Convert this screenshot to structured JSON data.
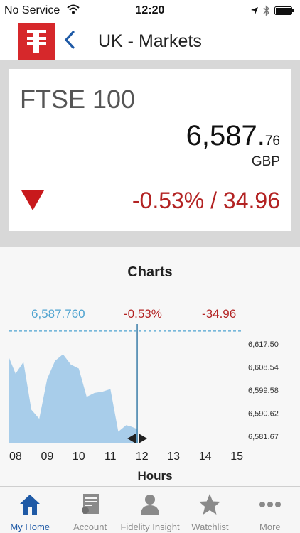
{
  "status_bar": {
    "carrier": "No Service",
    "time": "12:20"
  },
  "nav": {
    "title": "UK - Markets",
    "logo_icon": "fidelity-logo-icon",
    "back_icon": "chevron-left-icon"
  },
  "summary": {
    "index_name": "FTSE 100",
    "price_main": "6,587.",
    "price_decimals": "76",
    "currency": "GBP",
    "direction_icon": "down-triangle-icon",
    "change": "-0.53% / 34.96"
  },
  "chart": {
    "title": "Charts",
    "readout_value": "6,587.760",
    "readout_pct": "-0.53%",
    "readout_abs": "-34.96",
    "x_axis_label": "Hours"
  },
  "chart_data": {
    "type": "area",
    "title": "Charts",
    "xlabel": "Hours",
    "ylabel": "",
    "x_ticks": [
      "08",
      "09",
      "10",
      "11",
      "12",
      "13",
      "14",
      "15"
    ],
    "y_ticks": [
      "6,617.50",
      "6,608.54",
      "6,599.58",
      "6,590.62",
      "6,581.67"
    ],
    "ylim": [
      6581.67,
      6617.5
    ],
    "xlim": [
      7.8,
      15.2
    ],
    "reference_line": 6622.5,
    "cursor_x": 11.85,
    "series": [
      {
        "x": [
          7.8,
          8.0,
          8.25,
          8.5,
          8.75,
          9.0,
          9.25,
          9.5,
          9.75,
          10.0,
          10.25,
          10.5,
          10.75,
          11.0,
          11.25,
          11.5,
          11.65,
          11.85
        ],
        "y": [
          6612.0,
          6606.0,
          6610.5,
          6592.0,
          6588.5,
          6604.0,
          6611.0,
          6613.5,
          6609.5,
          6608.0,
          6597.0,
          6598.5,
          6599.0,
          6600.0,
          6583.5,
          6586.0,
          6585.5,
          6584.5
        ]
      }
    ],
    "colors": {
      "area": "#a8cdea",
      "cursor": "#3a7ca8",
      "reference": "#4ea3d0"
    }
  },
  "tabs": [
    {
      "label": "My Home",
      "icon": "home-icon",
      "active": true
    },
    {
      "label": "Account",
      "icon": "account-document-icon",
      "active": false
    },
    {
      "label": "Fidelity Insight",
      "icon": "person-icon",
      "active": false
    },
    {
      "label": "Watchlist",
      "icon": "star-icon",
      "active": false
    },
    {
      "label": "More",
      "icon": "more-dots-icon",
      "active": false
    }
  ]
}
